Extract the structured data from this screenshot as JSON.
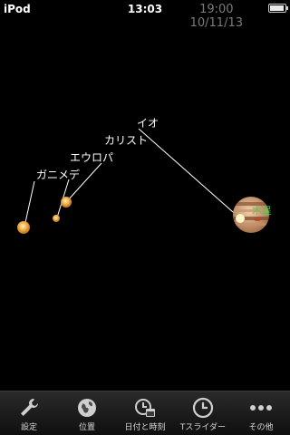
{
  "status_bar": {
    "carrier": "iPod",
    "time": "13:03"
  },
  "sim_time": {
    "time": "19:00",
    "date": "10/11/13"
  },
  "moons": {
    "io": "イオ",
    "callisto": "カリスト",
    "europa": "エウロパ",
    "ganymede": "ガニメデ",
    "jupiter": "木星"
  },
  "tabs": [
    {
      "label": "設定",
      "icon": "wrench-icon"
    },
    {
      "label": "位置",
      "icon": "globe-icon"
    },
    {
      "label": "日付と時刻",
      "icon": "clock-calendar-icon"
    },
    {
      "label": "Tスライダー",
      "icon": "clock-icon"
    },
    {
      "label": "その他",
      "icon": "more-icon"
    }
  ],
  "colors": {
    "moon": "#f2b04a",
    "jupiter_label": "#4dd04d",
    "tab_label": "#d8d8d8",
    "sim_time": "#7b7b7b"
  }
}
